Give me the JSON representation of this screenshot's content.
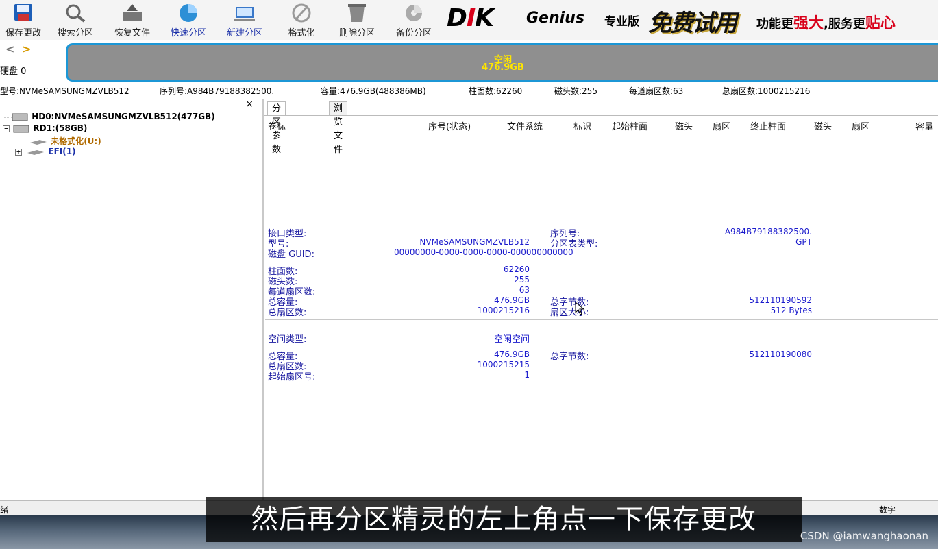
{
  "toolbar": {
    "items": [
      {
        "label": "保存更改",
        "icon": "save-icon"
      },
      {
        "label": "搜索分区",
        "icon": "search-icon"
      },
      {
        "label": "恢复文件",
        "icon": "restore-icon"
      },
      {
        "label": "快速分区",
        "icon": "quick-partition-icon"
      },
      {
        "label": "新建分区",
        "icon": "new-partition-icon"
      },
      {
        "label": "格式化",
        "icon": "format-icon"
      },
      {
        "label": "删除分区",
        "icon": "delete-icon"
      },
      {
        "label": "备份分区",
        "icon": "backup-icon"
      }
    ]
  },
  "brand": {
    "logo_prefix": "D",
    "logo_mark": "I",
    "logo_k": "K",
    "logo_suffix": "Genius",
    "edition": "专业版",
    "free_trial": "免费试用",
    "slogan_1": "功能更",
    "slogan_2": "强大",
    "slogan_3": ",服务更",
    "slogan_4": "贴心"
  },
  "nav": {
    "back": "<",
    "forward": ">",
    "disk_label": "硬盘 0"
  },
  "diskbar": {
    "line1": "空闲",
    "line2": "476.9GB"
  },
  "info": {
    "model": "型号:NVMeSAMSUNGMZVLB512",
    "serial": "序列号:A984B79188382500.",
    "capacity": "容量:476.9GB(488386MB)",
    "cylinders": "柱面数:62260",
    "heads": "磁头数:255",
    "sectors_per_track": "每道扇区数:63",
    "total_sectors": "总扇区数:1000215216"
  },
  "tree": {
    "close": "×",
    "hd0": "HD0:NVMeSAMSUNGMZVLB512(477GB)",
    "rd1": "RD1:(58GB)",
    "unformatted": "未格式化(U:)",
    "efi": "EFI(1)"
  },
  "tabs": [
    "分区参数",
    "浏览文件"
  ],
  "columns": [
    "卷标",
    "序号(状态)",
    "文件系统",
    "标识",
    "起始柱面",
    "磁头",
    "扇区",
    "终止柱面",
    "磁头",
    "扇区",
    "容量"
  ],
  "details": {
    "interface_type_label": "接口类型:",
    "serial_label": "序列号:",
    "serial_value": "A984B79188382500.",
    "model_label": "型号:",
    "model_value": "NVMeSAMSUNGMZVLB512",
    "table_type_label": "分区表类型:",
    "table_type_value": "GPT",
    "guid_label": "磁盘 GUID:",
    "guid_value": "00000000-0000-0000-0000-000000000000",
    "cylinders_label": "柱面数:",
    "cylinders_value": "62260",
    "heads_label": "磁头数:",
    "heads_value": "255",
    "spt_label": "每道扇区数:",
    "spt_value": "63",
    "capacity_label": "总容量:",
    "capacity_value": "476.9GB",
    "total_bytes_label": "总字节数:",
    "total_bytes_value": "512110190592",
    "total_sectors_label": "总扇区数:",
    "total_sectors_value": "1000215216",
    "sector_size_label": "扇区大小:",
    "sector_size_value": "512 Bytes",
    "space_type_label": "空间类型:",
    "space_type_value": "空闲空间",
    "free_capacity_label": "总容量:",
    "free_capacity_value": "476.9GB",
    "free_bytes_label": "总字节数:",
    "free_bytes_value": "512110190080",
    "free_sectors_label": "总扇区数:",
    "free_sectors_value": "1000215215",
    "start_sector_label": "起始扇区号:",
    "start_sector_value": "1"
  },
  "status": {
    "left": "绪",
    "right": "数字"
  },
  "subtitle": "然后再分区精灵的左上角点一下保存更改",
  "watermark": "CSDN @iamwanghaonan"
}
